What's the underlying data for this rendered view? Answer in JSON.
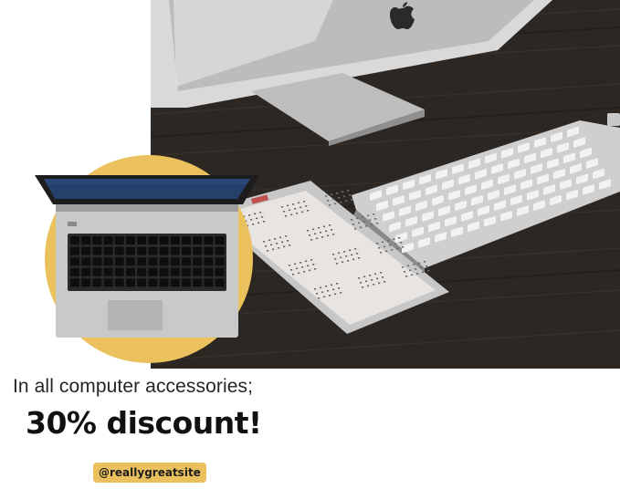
{
  "headline": "In all computer accessories;",
  "discount": "30% discount!",
  "handle": "@reallygreatsite",
  "colors": {
    "accent": "#eac15c",
    "desk": "#2b2521",
    "text": "#262626"
  },
  "icons": [
    "apple-logo-icon",
    "laptop-illustration",
    "keyboard",
    "tablet-calendar",
    "imac-monitor"
  ]
}
